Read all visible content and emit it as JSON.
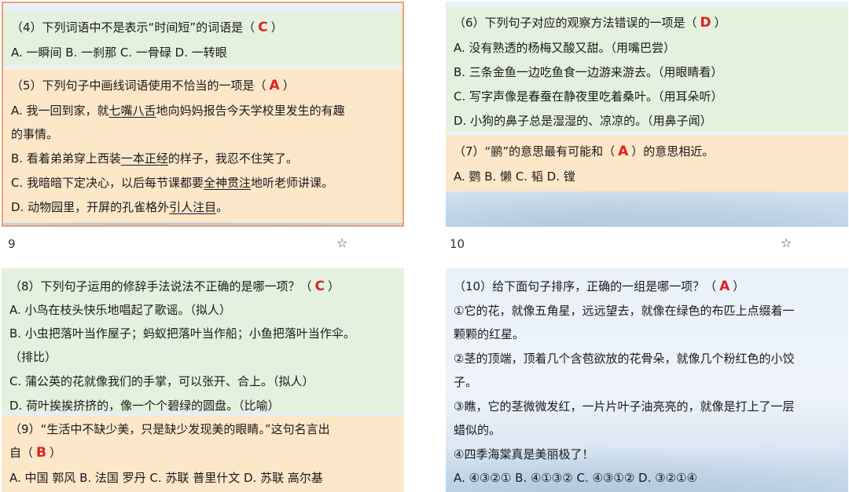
{
  "slides": [
    {
      "q4": {
        "prefix": "（4）下列词语中不是表示“时间短”的词语是（",
        "answer": "C",
        "suffix": "）",
        "options": "A. 一瞬间 B. 一刹那 C. 一骨碌 D. 一转眼"
      },
      "q5": {
        "prefix": "（5）下列句子中画线词语使用不恰当的一项是（",
        "answer": "A",
        "suffix": "）",
        "a_pre": "A. 我一回到家，就",
        "a_ul": "七嘴八舌",
        "a_post": "地向妈妈报告今天学校里发生的有趣",
        "a_cont": "的事情。",
        "b_pre": "B. 看着弟弟穿上西装",
        "b_ul": "一本正经",
        "b_post": "的样子，我忍不住笑了。",
        "c_pre": "C. 我暗暗下定决心，以后每节课都要",
        "c_ul": "全神贯注",
        "c_post": "地听老师讲课。",
        "d_pre": "D. 动物园里，开屏的孔雀格外",
        "d_ul": "引人注目",
        "d_post": "。"
      }
    },
    {
      "q6": {
        "prefix": "（6）下列句子对应的观察方法错误的一项是（",
        "answer": "D",
        "suffix": "）",
        "a": "A. 没有熟透的杨梅又酸又甜。（用嘴巴尝）",
        "b": "B. 三条金鱼一边吃鱼食一边游来游去。（用眼睛看）",
        "c": "C. 写字声像是春蚕在静夜里吃着桑叶。（用耳朵听）",
        "d": "D. 小狗的鼻子总是湿湿的、凉凉的。（用鼻子闻）"
      },
      "q7": {
        "prefix": "（7）“鹂”的意思最有可能和（",
        "answer": "A",
        "suffix": "）的意思相近。",
        "options": "A. 鹦 B. 懒 C. 韬 D. 镗"
      }
    },
    {
      "q8": {
        "prefix": "（8）下列句子运用的修辞手法说法不正确的是哪一项？（",
        "answer": "C",
        "suffix": "）",
        "a": "A. 小鸟在枝头快乐地唱起了歌谣。（拟人）",
        "b": "B. 小虫把落叶当作屋子；蚂蚁把落叶当作船；小鱼把落叶当作伞。",
        "b_cont": "（排比）",
        "c": "C. 蒲公英的花就像我们的手掌，可以张开、合上。（拟人）",
        "d": "D. 荷叶挨挨挤挤的，像一个个碧绿的圆盘。（比喻）"
      },
      "q9": {
        "line1": "（9）“生活中不缺少美，只是缺少发现美的眼睛。”这句名言出",
        "prefix": "自（",
        "answer": "B",
        "suffix": "）",
        "options": "A. 中国 郭风 B. 法国 罗丹 C. 苏联 普里什文 D. 苏联 高尔基"
      }
    },
    {
      "q10": {
        "prefix": "（10）给下面句子排序，正确的一组是哪一项？（",
        "answer": "A",
        "suffix": "）",
        "s1": "①它的花，就像五角星，远远望去，就像在绿色的布匹上点缀着一",
        "s1_cont": "颗颗的红星。",
        "s2": "②茎的顶端，顶着几个含苞欲放的花骨朵，就像几个粉红色的小饺",
        "s2_cont": "子。",
        "s3": "③瞧，它的茎微微发红，一片片叶子油亮亮的，就像是打上了一层",
        "s3_cont": "蜡似的。",
        "s4": "④四季海棠真是美丽极了！",
        "options": "A. ④③②① B. ④①③② C. ④③①② D. ③②①④"
      }
    }
  ],
  "page_numbers": [
    "9",
    "10"
  ],
  "colors": {
    "answer": "#e02020",
    "green_box": "#e4f1df",
    "peach_box": "#fde7c9",
    "selected_border": "#f0a070"
  },
  "icons": {
    "favorite": "star-outline-icon"
  }
}
